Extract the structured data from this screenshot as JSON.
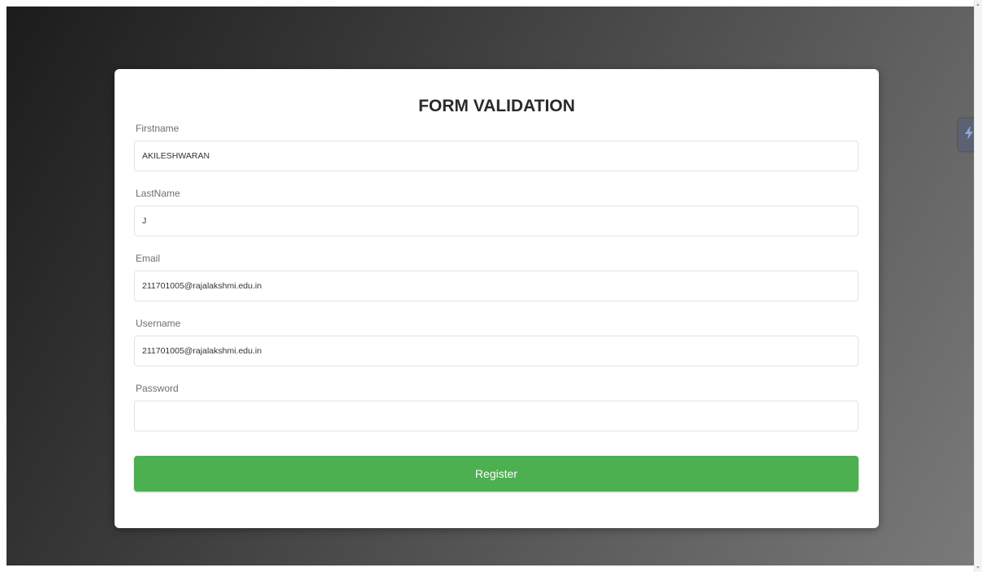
{
  "form": {
    "title": "FORM VALIDATION",
    "fields": [
      {
        "label": "Firstname",
        "value": "AKILESHWARAN",
        "placeholder": ""
      },
      {
        "label": "LastName",
        "value": "J",
        "placeholder": ""
      },
      {
        "label": "Email",
        "value": "211701005@rajalakshmi.edu.in",
        "placeholder": ""
      },
      {
        "label": "Username",
        "value": "211701005@rajalakshmi.edu.in",
        "placeholder": ""
      },
      {
        "label": "Password",
        "value": "",
        "placeholder": ""
      }
    ],
    "submit_label": "Register"
  },
  "extension": {
    "icon": "lightning-icon"
  },
  "colors": {
    "accent": "#4caf50",
    "card_background": "#ffffff",
    "extension_button": "#5b6274"
  }
}
